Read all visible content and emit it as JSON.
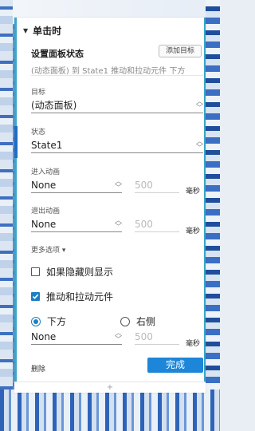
{
  "section": {
    "title": "单击时"
  },
  "panel": {
    "title": "设置面板状态",
    "add_target": "添加目标",
    "description": "(动态面板) 到 State1 推动和拉动元件 下方"
  },
  "target": {
    "label": "目标",
    "value": "(动态面板)"
  },
  "state": {
    "label": "状态",
    "value": "State1"
  },
  "enter_anim": {
    "label": "进入动画",
    "value": "None",
    "duration": "500",
    "unit": "毫秒"
  },
  "exit_anim": {
    "label": "退出动画",
    "value": "None",
    "duration": "500",
    "unit": "毫秒"
  },
  "more_options": "更多选项 ▾",
  "hide_option": {
    "label": "如果隐藏则显示",
    "checked": false
  },
  "push_pull": {
    "label": "推动和拉动元件",
    "checked": true
  },
  "direction": {
    "below": {
      "label": "下方",
      "selected": true
    },
    "right": {
      "label": "右侧",
      "selected": false
    }
  },
  "push_anim": {
    "value": "None",
    "duration": "500",
    "unit": "毫秒"
  },
  "footer": {
    "delete": "删除",
    "done": "完成",
    "add": "+"
  },
  "colors": {
    "accent": "#1d86d8",
    "panel_border": "#3aa6c8"
  }
}
